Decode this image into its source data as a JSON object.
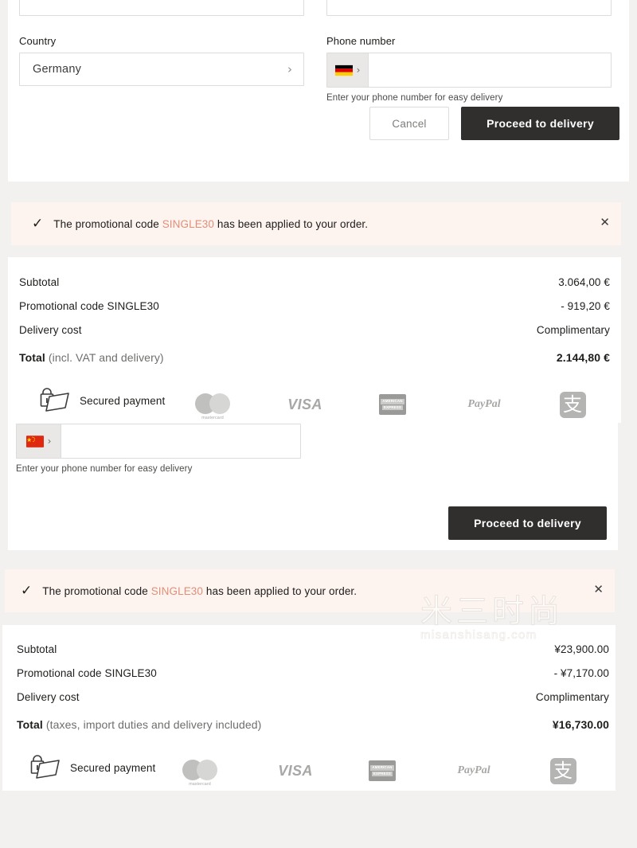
{
  "address_form": {
    "country": {
      "label": "Country",
      "value": "Germany",
      "chevron": "chevron-right-icon"
    },
    "phone": {
      "label": "Phone number",
      "value": "",
      "placeholder": "",
      "flag": "flag-germany",
      "chevron": "chevron-right-icon",
      "helper": "Enter your phone number for easy delivery"
    },
    "actions": {
      "cancel_label": "Cancel",
      "submit_label": "Proceed to delivery"
    }
  },
  "secondary_form": {
    "phone": {
      "value": "",
      "flag": "flag-china",
      "chevron": "chevron-right-icon",
      "helper": "Enter your phone number for easy delivery"
    },
    "actions": {
      "submit_label": "Proceed to delivery"
    }
  },
  "promo_banner_eur": {
    "check_icon": "check-icon",
    "text_before": "The promotional code",
    "code": "SINGLE30",
    "text_after": "has been applied to your order.",
    "close_icon": "close-icon",
    "background": "#fdf3ef",
    "code_color": "#e08f79"
  },
  "promo_banner_cny": {
    "check_icon": "check-icon",
    "text_before": "The promotional code",
    "code": "SINGLE30",
    "text_after": "has been applied to your order.",
    "close_icon": "close-icon",
    "background": "#fdf3ef",
    "code_color": "#e08f79"
  },
  "summary_eur": {
    "rows": [
      {
        "label": "Subtotal",
        "amount": "3.064,00 €"
      },
      {
        "label": "Promotional code SINGLE30",
        "amount": "- 919,20 €"
      },
      {
        "label": "Delivery cost",
        "amount": "Complimentary"
      }
    ],
    "total": {
      "label": "Total",
      "note": "(incl. VAT and delivery)",
      "amount": "2.144,80 €"
    }
  },
  "summary_cny": {
    "rows": [
      {
        "label": "Subtotal",
        "amount": "¥23,900.00"
      },
      {
        "label": "Promotional code SINGLE30",
        "amount": "- ¥7,170.00"
      },
      {
        "label": "Delivery cost",
        "amount": "Complimentary"
      }
    ],
    "total": {
      "label": "Total",
      "note": "(taxes, import duties and delivery included)",
      "amount": "¥16,730.00"
    }
  },
  "payment_strip_top": {
    "secured_icon": "secure-card-lock-icon",
    "secured_label": "Secured payment",
    "logos": [
      {
        "name": "mastercard-logo",
        "wordmark": "mastercard"
      },
      {
        "name": "visa-logo",
        "wordmark": "VISA"
      },
      {
        "name": "amex-logo",
        "line1": "AMERICAN",
        "line2": "EXPRESS"
      },
      {
        "name": "paypal-logo",
        "wordmark": "PayPal"
      },
      {
        "name": "alipay-logo",
        "glyph": "支"
      }
    ]
  },
  "payment_strip_bottom": {
    "secured_icon": "secure-card-lock-icon",
    "secured_label": "Secured payment",
    "logos": [
      {
        "name": "mastercard-logo",
        "wordmark": "mastercard"
      },
      {
        "name": "visa-logo",
        "wordmark": "VISA"
      },
      {
        "name": "amex-logo",
        "line1": "AMERICAN",
        "line2": "EXPRESS"
      },
      {
        "name": "paypal-logo",
        "wordmark": "PayPal"
      },
      {
        "name": "alipay-logo",
        "glyph": "支"
      }
    ]
  },
  "watermark": {
    "chinese": "米三时尚",
    "latin": "misanshisang.com"
  }
}
